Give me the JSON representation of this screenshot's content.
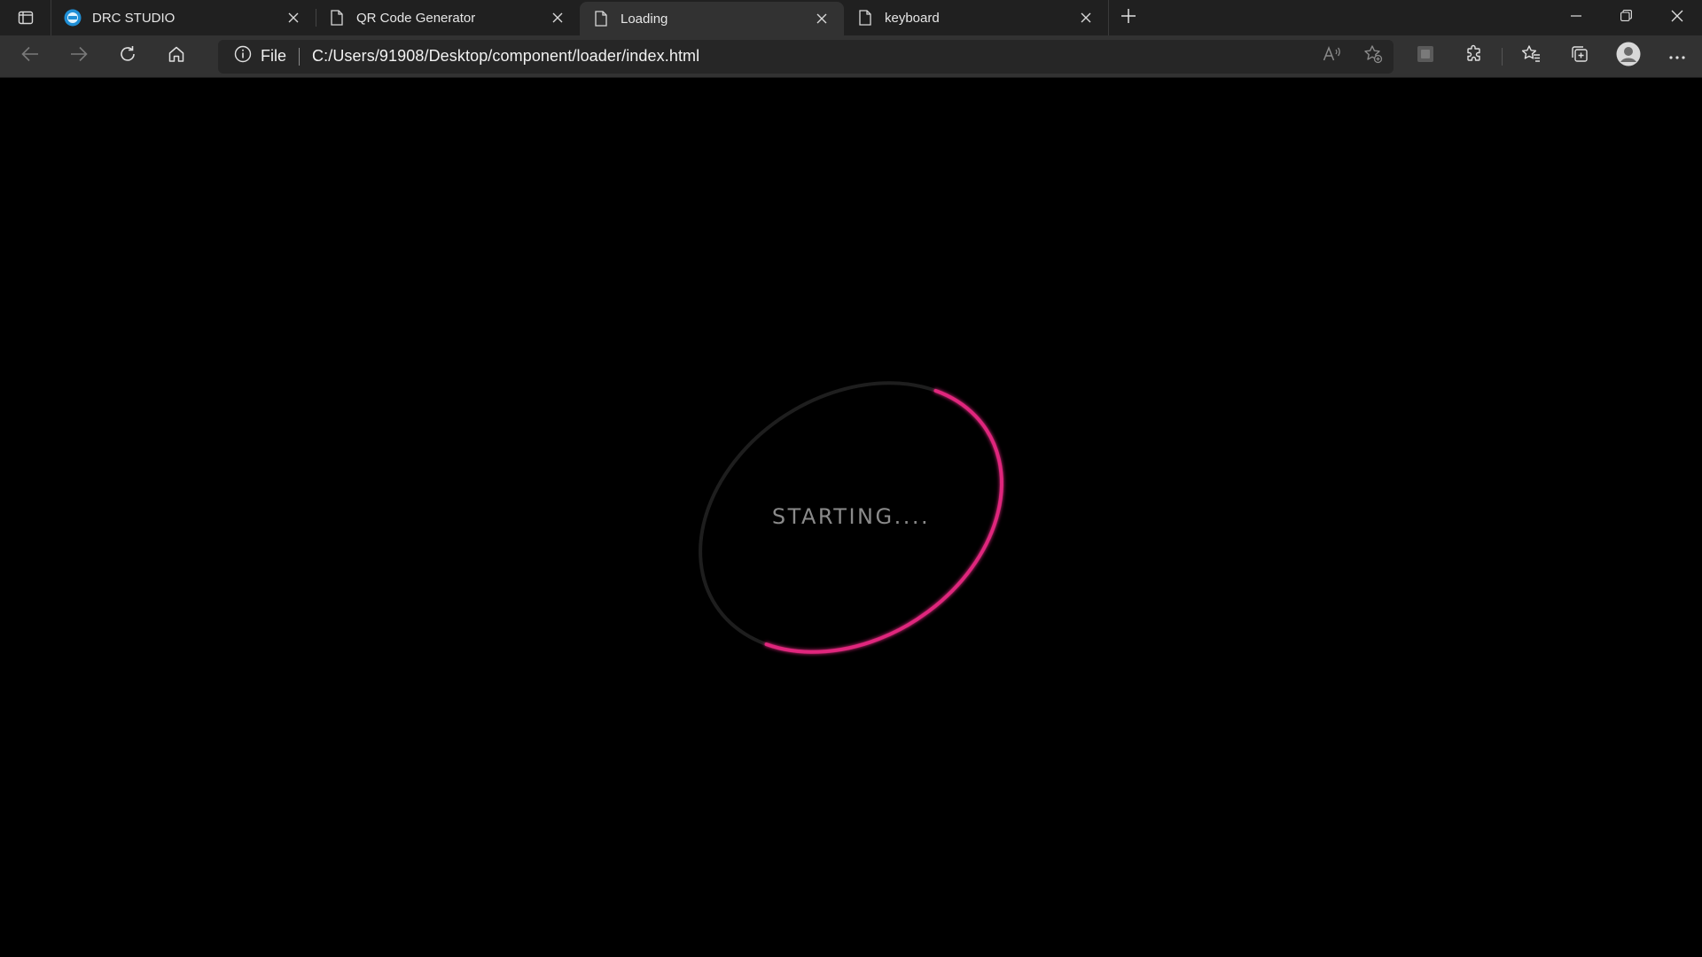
{
  "browser": {
    "tabs": [
      {
        "title": "DRC STUDIO",
        "icon": "site-favicon",
        "active": false
      },
      {
        "title": "QR Code Generator",
        "icon": "page-icon",
        "active": false
      },
      {
        "title": "Loading",
        "icon": "page-icon",
        "active": true
      },
      {
        "title": "keyboard",
        "icon": "page-icon",
        "active": false
      }
    ],
    "address": {
      "scheme_label": "File",
      "url": "C:/Users/91908/Desktop/component/loader/index.html"
    }
  },
  "page": {
    "loader_text": "STARTING....",
    "colors": {
      "background": "#000000",
      "ring_track": "#1e1e1e",
      "ring_accent": "#e0267d",
      "text": "#8a8a8a"
    }
  }
}
